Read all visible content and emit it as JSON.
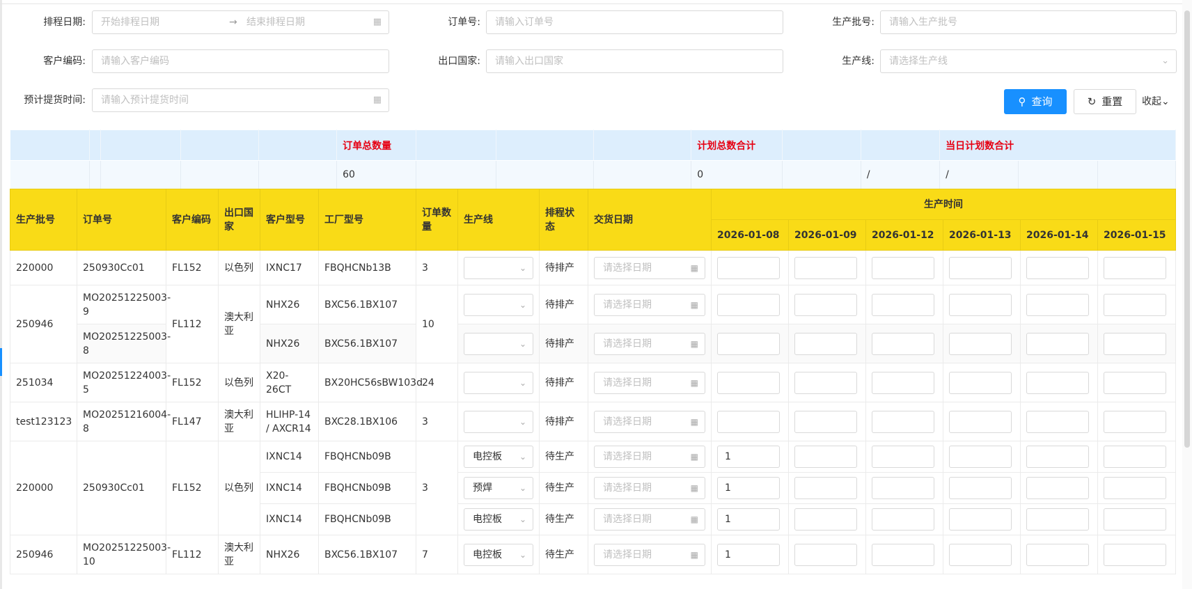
{
  "filters": {
    "schedule_date_label": "排程日期:",
    "schedule_start_placeholder": "开始排程日期",
    "schedule_end_placeholder": "结束排程日期",
    "order_no_label": "订单号:",
    "order_no_placeholder": "请输入订单号",
    "batch_no_label": "生产批号:",
    "batch_no_placeholder": "请输入生产批号",
    "customer_code_label": "客户编码:",
    "customer_code_placeholder": "请输入客户编码",
    "export_country_label": "出口国家:",
    "export_country_placeholder": "请输入出口国家",
    "line_label": "生产线:",
    "line_placeholder": "请选择生产线",
    "pickup_time_label": "预计提货时间:",
    "pickup_time_placeholder": "请输入预计提货时间"
  },
  "buttons": {
    "query": "查询",
    "reset": "重置",
    "collapse": "收起"
  },
  "summary": {
    "order_total_label": "订单总数量",
    "plan_total_label": "计划总数合计",
    "daily_plan_total_label": "当日计划数合计",
    "order_total_value": "60",
    "plan_total_value": "0",
    "daily_a": "/",
    "daily_b": "/"
  },
  "table": {
    "headers": {
      "batch": "生产批号",
      "order": "订单号",
      "customer": "客户编码",
      "country": "出口国家",
      "customer_model": "客户型号",
      "factory_model": "工厂型号",
      "qty": "订单数量",
      "line": "生产线",
      "status": "排程状态",
      "delivery": "交货日期",
      "production_time": "生产时间"
    },
    "dates": [
      "2026-01-08",
      "2026-01-09",
      "2026-01-12",
      "2026-01-13",
      "2026-01-14",
      "2026-01-15"
    ],
    "date_placeholder": "请选择日期",
    "rows": [
      {
        "batch": "220000",
        "order": "250930Cc01",
        "customer": "FL152",
        "country": "以色列",
        "cmodel": "IXNC17",
        "fmodel": "FBQHCNb13B",
        "qty": "3",
        "line": "",
        "status": "待排产",
        "d1": ""
      },
      {
        "batch": "250946",
        "order": "MO20251225003-9",
        "customer": "FL112",
        "country": "澳大利亚",
        "cmodel": "NHX26",
        "fmodel": "BXC56.1BX107",
        "qty": "10",
        "line": "",
        "status": "待排产",
        "d1": ""
      },
      {
        "order": "MO20251225003-8",
        "cmodel": "NHX26",
        "fmodel": "BXC56.1BX107",
        "line": "",
        "status": "待排产",
        "d1": ""
      },
      {
        "batch": "251034",
        "order": "MO20251224003-5",
        "customer": "FL152",
        "country": "以色列",
        "cmodel": "X20-26CT",
        "fmodel": "BX20HC56sBW103d",
        "qty": "24",
        "line": "",
        "status": "待排产",
        "d1": ""
      },
      {
        "batch": "test123123",
        "order": "MO20251216004-8",
        "customer": "FL147",
        "country": "澳大利亚",
        "cmodel": "HLIHP-14 / AXCR14",
        "fmodel": "BXC28.1BX106",
        "qty": "3",
        "line": "",
        "status": "待排产",
        "d1": ""
      },
      {
        "batch": "220000",
        "order": "250930Cc01",
        "customer": "FL152",
        "country": "以色列",
        "cmodel": "IXNC14",
        "fmodel": "FBQHCNb09B",
        "qty": "3",
        "line": "电控板",
        "status": "待生产",
        "d1": "1"
      },
      {
        "cmodel": "IXNC14",
        "fmodel": "FBQHCNb09B",
        "line": "预焊",
        "status": "待生产",
        "d1": "1"
      },
      {
        "cmodel": "IXNC14",
        "fmodel": "FBQHCNb09B",
        "line": "电控板",
        "status": "待生产",
        "d1": "1"
      },
      {
        "batch": "250946",
        "order": "MO20251225003-10",
        "customer": "FL112",
        "country": "澳大利亚",
        "cmodel": "NHX26",
        "fmodel": "BXC56.1BX107",
        "qty": "7",
        "line": "电控板",
        "status": "待生产",
        "d1": "1"
      }
    ]
  },
  "colors": {
    "header_yellow": "#f9db17",
    "summary_red": "#e60012",
    "primary_blue": "#1890ff"
  }
}
